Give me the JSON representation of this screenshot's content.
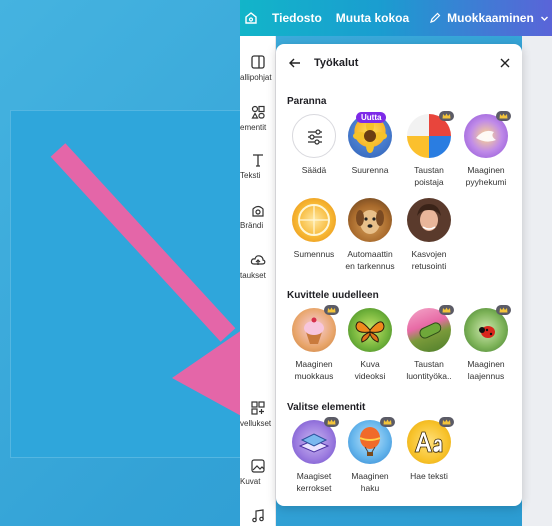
{
  "topbar": {
    "file_label": "Tiedosto",
    "resize_label": "Muuta kokoa",
    "edit_label": "Muokkaaminen"
  },
  "sidebar": {
    "items": [
      {
        "label": "allipohjat",
        "icon": "template-icon"
      },
      {
        "label": "ementit",
        "icon": "elements-icon"
      },
      {
        "label": "Teksti",
        "icon": "text-icon"
      },
      {
        "label": "Brändi",
        "icon": "brand-icon"
      },
      {
        "label": "taukset",
        "icon": "upload-icon"
      },
      {
        "label": "vellukset",
        "icon": "apps-icon"
      },
      {
        "label": "Kuvat",
        "icon": "photos-icon"
      }
    ]
  },
  "panel": {
    "title": "Työkalut",
    "sections": [
      {
        "title": "Paranna",
        "tools": [
          {
            "label1": "Säädä",
            "label2": ""
          },
          {
            "label1": "Suurenna",
            "label2": "",
            "badge": "Uutta"
          },
          {
            "label1": "Taustan",
            "label2": "poistaja"
          },
          {
            "label1": "Maaginen",
            "label2": "pyyhekumi"
          },
          {
            "label1": "Sumennus",
            "label2": ""
          },
          {
            "label1": "Automaattin",
            "label2": "en tarkennus"
          },
          {
            "label1": "Kasvojen",
            "label2": "retusointi"
          }
        ]
      },
      {
        "title": "Kuvittele uudelleen",
        "tools": [
          {
            "label1": "Maaginen",
            "label2": "muokkaus"
          },
          {
            "label1": "Kuva",
            "label2": "videoksi"
          },
          {
            "label1": "Taustan",
            "label2": "luontityökа.."
          },
          {
            "label1": "Maaginen",
            "label2": "laajennus"
          }
        ]
      },
      {
        "title": "Valitse elementit",
        "tools": [
          {
            "label1": "Maagiset",
            "label2": "kerrokset"
          },
          {
            "label1": "Maaginen",
            "label2": "haku"
          },
          {
            "label1": "Hae teksti",
            "label2": ""
          }
        ]
      }
    ]
  },
  "colors": {
    "arrow": "#e466a8",
    "accent_purple": "#7d2ae8",
    "topbar_start": "#12b5c9",
    "topbar_end": "#5a64d8"
  }
}
